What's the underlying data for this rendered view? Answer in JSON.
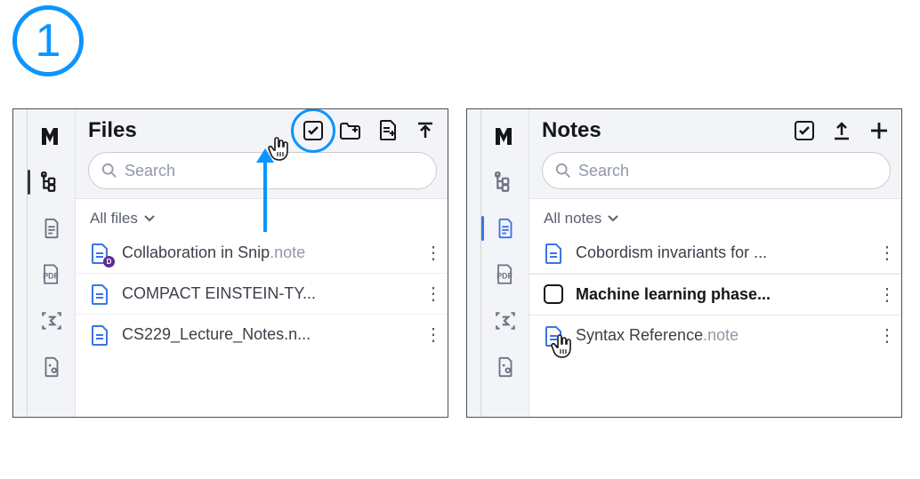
{
  "step": "1",
  "panel1": {
    "title": "Files",
    "search_placeholder": "Search",
    "filter_label": "All files",
    "items": [
      {
        "label": "Collaboration in Snip",
        "ext": ".note",
        "shared": true
      },
      {
        "label": "COMPACT EINSTEIN-TY...",
        "ext": "",
        "shared": false
      },
      {
        "label": "CS229_Lecture_Notes.n...",
        "ext": "",
        "shared": false
      }
    ]
  },
  "panel2": {
    "title": "Notes",
    "search_placeholder": "Search",
    "filter_label": "All notes",
    "items": [
      {
        "label": "Cobordism invariants for ...",
        "ext": "",
        "bold": false
      },
      {
        "label": "Machine learning phase...",
        "ext": "",
        "bold": true,
        "selecting": true
      },
      {
        "label": "Syntax Reference",
        "ext": ".note",
        "bold": false
      }
    ]
  },
  "icons": {
    "shared_badge": "D"
  }
}
